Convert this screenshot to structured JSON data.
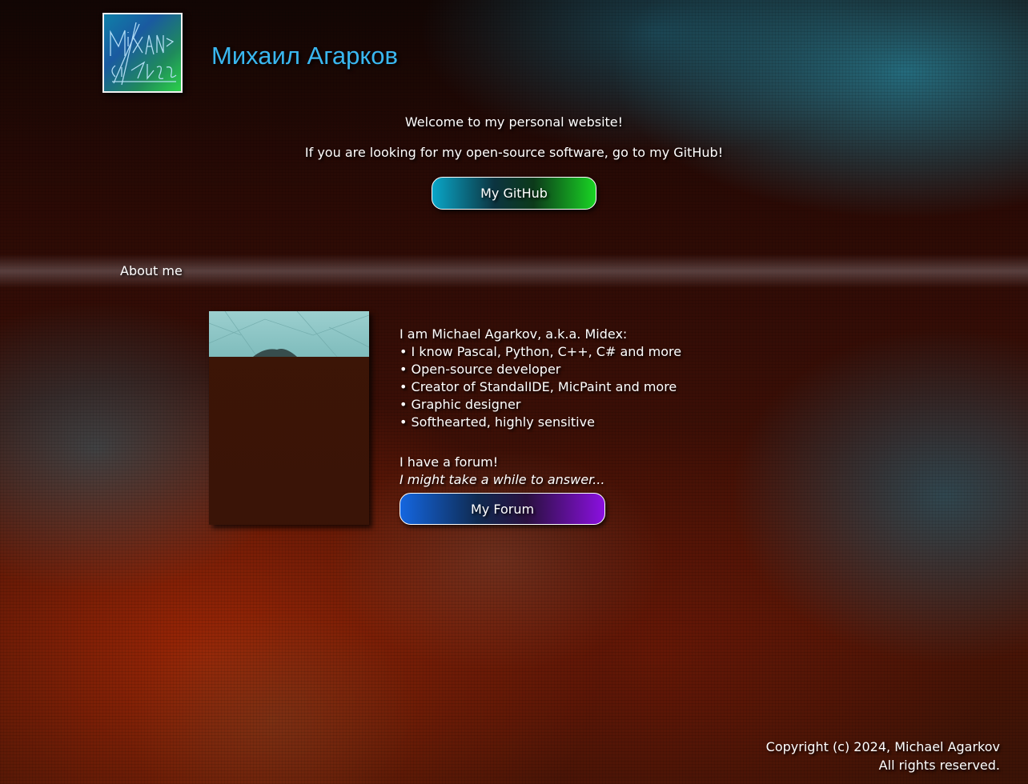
{
  "header": {
    "title": "Михаил Агарков",
    "logo_icon": "signature-logo-icon"
  },
  "intro": {
    "welcome": "Welcome to my personal website!",
    "hint": "If you are looking for my open-source software, go to my GitHub!",
    "github_button": "My GitHub"
  },
  "about": {
    "title": "About me",
    "photo_icon": "portrait-photo",
    "intro_line": "I am Michael Agarkov, a.k.a. Midex:",
    "items": [
      "• I know Pascal, Python, C++, C# and more",
      "• Open-source developer",
      "• Creator of StandalIDE, MicPaint and more",
      "• Graphic designer",
      "• Softhearted, highly sensitive"
    ],
    "forum_text": "I have a forum!",
    "forum_note": "I might take a while to answer...",
    "forum_button": "My Forum"
  },
  "footer": {
    "copyright": "Copyright (c) 2024, Michael Agarkov",
    "rights": "All rights reserved."
  },
  "colors": {
    "title": "#3ab7f0",
    "github_gradient": [
      "#0aa6c8",
      "#19d424"
    ],
    "forum_gradient": [
      "#1466e0",
      "#8b10e0"
    ]
  }
}
